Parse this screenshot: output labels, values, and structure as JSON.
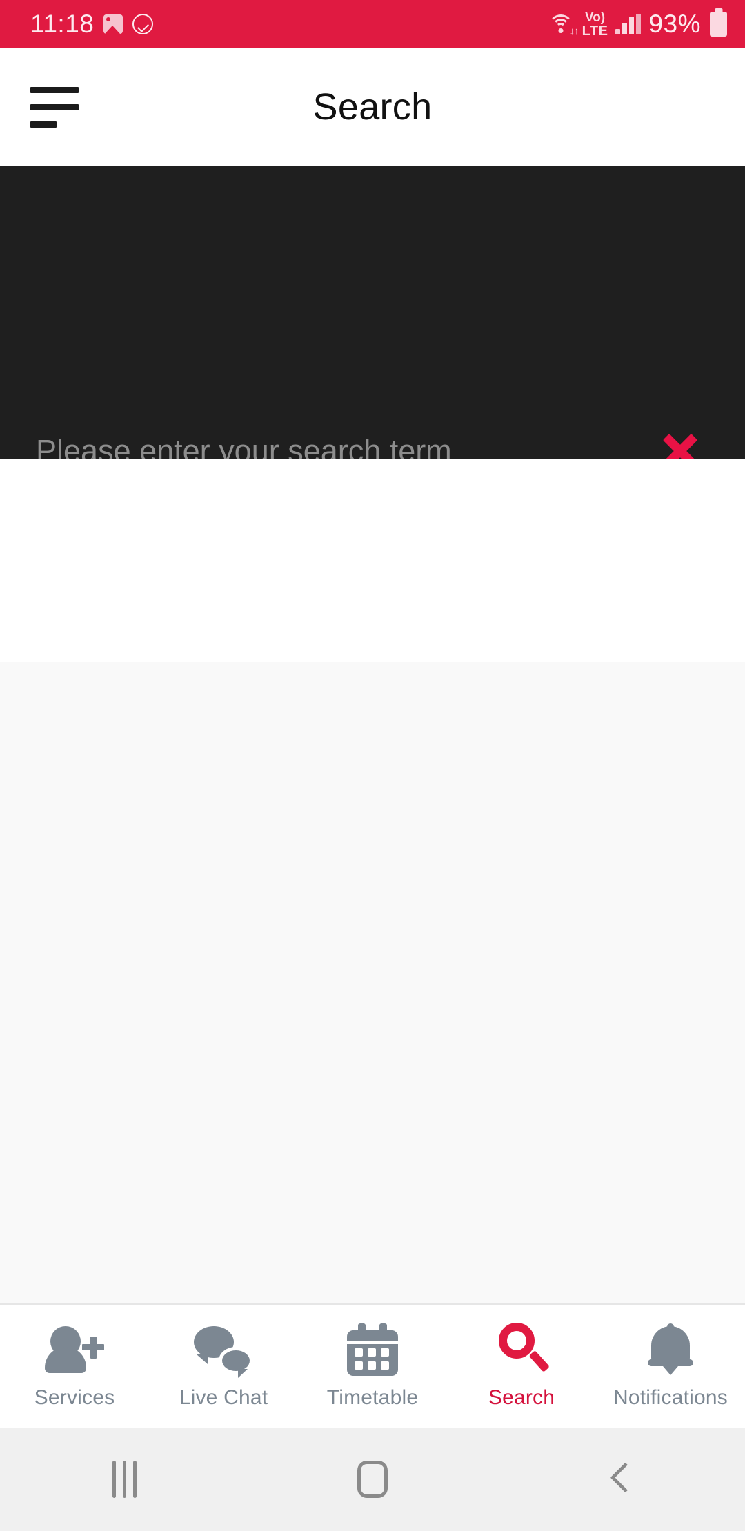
{
  "status_bar": {
    "time": "11:18",
    "icons_left": [
      "image-icon",
      "check-circle-icon"
    ],
    "wifi_icon": "wifi-icon",
    "wifi_arrows": "↓↑",
    "volte_line1": "Vo)",
    "volte_line2": "LTE",
    "signal_icon": "signal-bars-icon",
    "battery_percent": "93%",
    "battery_icon": "battery-icon",
    "background_color": "#E01A41"
  },
  "app_bar": {
    "menu_icon": "hamburger-menu-icon",
    "title": "Search"
  },
  "search_panel": {
    "placeholder": "Please enter your search term",
    "value": "",
    "clear_icon": "close-x-icon",
    "background_color": "#1f1f1f",
    "underline_color": "#E01A41"
  },
  "results": {
    "items": [],
    "background_color": "#f9f9f9"
  },
  "tab_bar": {
    "active_color": "#D4113C",
    "inactive_color": "#7c8792",
    "tabs": [
      {
        "label": "Services",
        "icon": "person-add-icon",
        "active": false
      },
      {
        "label": "Live Chat",
        "icon": "chat-bubbles-icon",
        "active": false
      },
      {
        "label": "Timetable",
        "icon": "calendar-icon",
        "active": false
      },
      {
        "label": "Search",
        "icon": "search-icon",
        "active": true
      },
      {
        "label": "Notifications",
        "icon": "bell-icon",
        "active": false
      }
    ]
  },
  "system_nav": {
    "recents_icon": "recents-icon",
    "home_icon": "home-icon",
    "back_icon": "back-icon"
  }
}
